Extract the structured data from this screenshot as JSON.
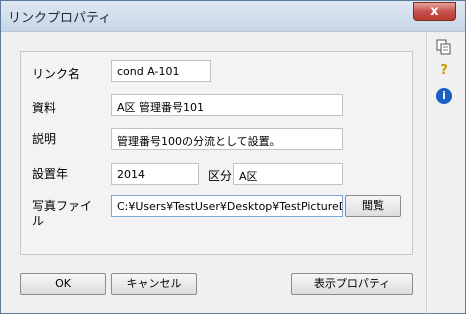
{
  "window": {
    "title": "リンクプロパティ",
    "close_glyph": "x"
  },
  "form": {
    "link_name": {
      "label": "リンク名",
      "value": "cond A-101"
    },
    "material": {
      "label": "資料",
      "value": "A区 管理番号101"
    },
    "description": {
      "label": "説明",
      "value": "管理番号100の分流として設置。"
    },
    "install_year": {
      "label": "設置年",
      "value": "2014"
    },
    "category": {
      "label": "区分",
      "value": "A区"
    },
    "photo_file": {
      "label_line1": "写真ファイ",
      "label_line2": "ル",
      "value": "C:¥Users¥TestUser¥Desktop¥TestPictureData.j"
    },
    "browse_label": "閲覧"
  },
  "buttons": {
    "ok": "OK",
    "cancel": "キャンセル",
    "display_properties": "表示プロパティ"
  },
  "sidebar": {
    "help_glyph": "?",
    "info_glyph": "i"
  }
}
